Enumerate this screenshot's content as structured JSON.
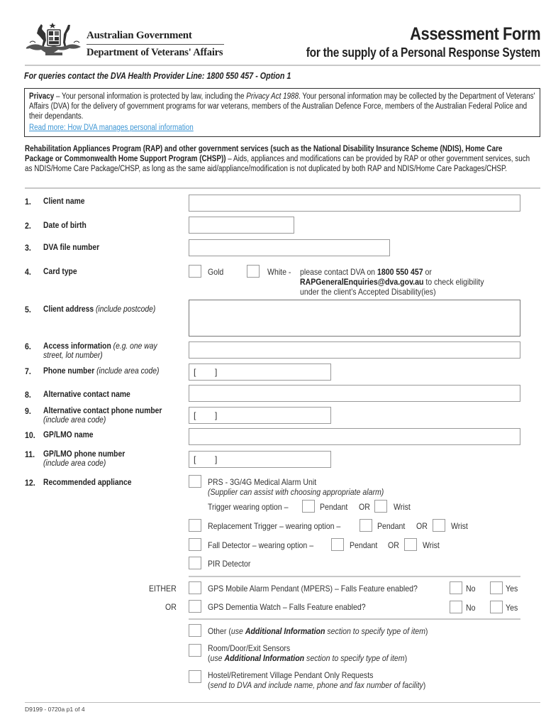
{
  "header": {
    "crest_icon": "coat-of-arms-icon",
    "government": "Australian Government",
    "department": "Department of Veterans' Affairs",
    "title": "Assessment Form",
    "subtitle": "for the supply of a Personal Response System"
  },
  "queries": "For queries contact the DVA Health Provider Line: 1800 550 457 - Option 1",
  "privacy": {
    "heading": "Privacy",
    "text_1": " – Your personal information is protected by law, including the ",
    "act": "Privacy Act 1988",
    "text_2": ". Your personal information may be collected by the Department of Veterans' Affairs (DVA) for the delivery of government programs for war veterans, members of the Australian Defence Force, members of the Australian Federal Police and their dependants.",
    "link": "Read more:  How DVA manages personal information"
  },
  "rap": {
    "bold": "Rehabilitation Appliances Program (RAP) and other government services (such as the National Disability Insurance Scheme (NDIS), Home Care Package or Commonwealth Home Support Program (CHSP))",
    "text": " – Aids, appliances and modifications can be provided by RAP or other government services, such as NDIS/Home Care Package/CHSP, as long as the same aid/appliance/modification is not duplicated by both RAP and NDIS/Home Care Packages/CHSP."
  },
  "questions": {
    "q1": {
      "num": "1.",
      "label": "Client name",
      "value": ""
    },
    "q2": {
      "num": "2.",
      "label": "Date of birth",
      "value": ""
    },
    "q3": {
      "num": "3.",
      "label": "DVA file number",
      "value": ""
    },
    "q4": {
      "num": "4.",
      "label": "Card type",
      "gold": "Gold",
      "white": "White -",
      "note_1": "please contact DVA on ",
      "phone": "1800 550 457",
      "note_2": " or",
      "email": "RAPGeneralEnquiries@dva.gov.au",
      "note_3": " to check eligibility",
      "note_4": "under the client's Accepted Disability(ies)"
    },
    "q5": {
      "num": "5.",
      "label": "Client address",
      "hint": " (include postcode)",
      "value": ""
    },
    "q6": {
      "num": "6.",
      "label": "Access information",
      "hint": " (e.g. one way",
      "hint_2": "street, lot number)",
      "value": ""
    },
    "q7": {
      "num": "7.",
      "label": "Phone number",
      "hint": " (include area code)",
      "value": "[        ]"
    },
    "q8": {
      "num": "8.",
      "label": "Alternative contact name",
      "value": ""
    },
    "q9": {
      "num": "9.",
      "label": "Alternative contact phone number",
      "hint_2": "(include area code)",
      "value": "[        ]"
    },
    "q10": {
      "num": "10.",
      "label": "GP/LMO name",
      "value": ""
    },
    "q11": {
      "num": "11.",
      "label": "GP/LMO phone number",
      "hint_2": "(include area code)",
      "value": "[        ]"
    },
    "q12": {
      "num": "12.",
      "label": "Recommended appliance",
      "prs": "PRS - 3G/4G Medical Alarm Unit",
      "prs_note": "(Supplier can assist with choosing appropriate alarm)",
      "trigger": "Trigger wearing option –",
      "pendant": "Pendant",
      "or": "OR",
      "wrist": "Wrist",
      "replacement": "Replacement Trigger – wearing option –",
      "fall": "Fall Detector – wearing option –",
      "pir": "PIR Detector",
      "either": "EITHER",
      "or_label": "OR",
      "gps_pendant": "GPS Mobile Alarm Pendant (MPERS) – Falls Feature enabled?",
      "gps_watch": "GPS Dementia Watch – Falls Feature enabled?",
      "no": "No",
      "yes": "Yes",
      "other_1": "Other (",
      "other_2": "use ",
      "addl": "Additional Information",
      "other_3": " section to specify type of item",
      "other_4": ")",
      "sensors": "Room/Door/Exit Sensors",
      "sensors_1": "(",
      "sensors_2": "use ",
      "sensors_3": " section to specify type of item",
      "sensors_4": ")",
      "hostel": "Hostel/Retirement Village Pendant Only Requests",
      "hostel_1": "(",
      "hostel_2": "send to DVA and include name, phone and fax number of facility",
      "hostel_3": ")"
    }
  },
  "footer": "D9199 - 0720a p1 of 4"
}
